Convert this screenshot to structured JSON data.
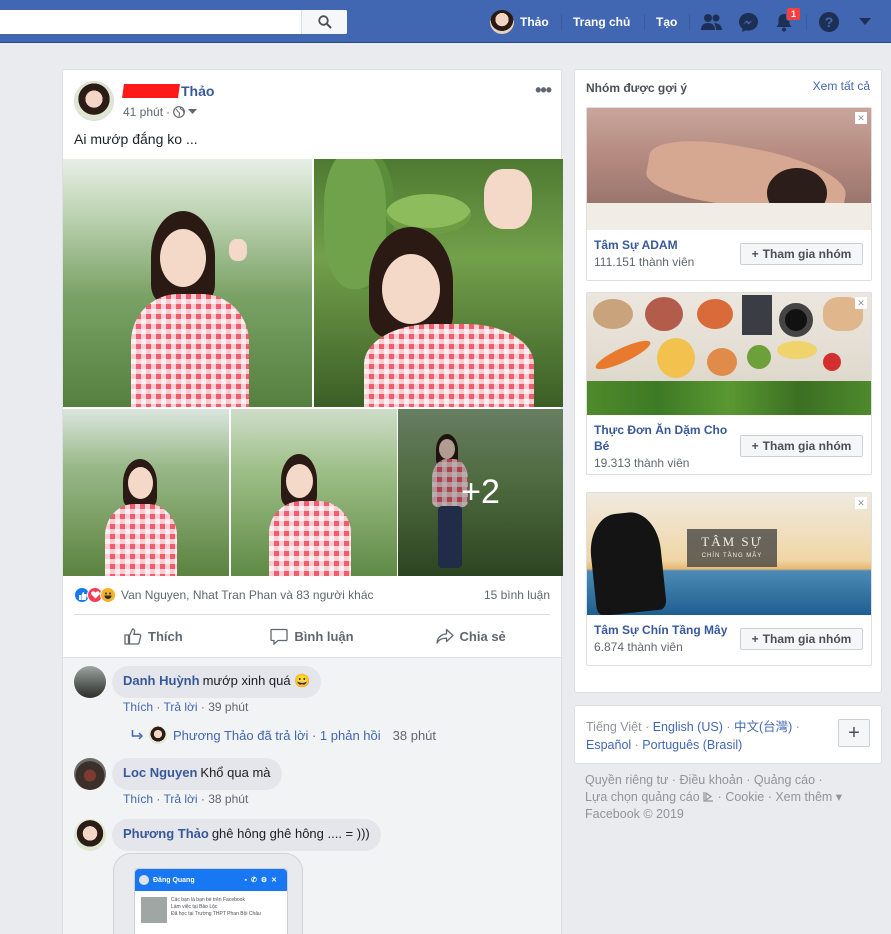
{
  "topbar": {
    "user_name": "Thảo",
    "home_label": "Trang chủ",
    "create_label": "Tạo",
    "notification_count": "1",
    "search_placeholder": ""
  },
  "post": {
    "author_visible": "Thảo",
    "time": "41 phút",
    "text": "Ai mướp đắng ko ...",
    "more_photos": "+2",
    "reactions_text": "Van Nguyen, Nhat Tran Phan và 83 người khác",
    "comments_count": "15 bình luận",
    "actions": {
      "like": "Thích",
      "comment": "Bình luận",
      "share": "Chia sẻ"
    }
  },
  "comments": [
    {
      "name": "Danh Huỳnh",
      "text": "mướp xinh quá 😀",
      "like": "Thích",
      "reply": "Trả lời",
      "time": "39 phút"
    },
    {
      "name": "Loc Nguyen",
      "text": "Khổ qua mà",
      "like": "Thích",
      "reply": "Trả lời",
      "time": "38 phút"
    },
    {
      "name": "Phương Thảo",
      "text": "ghê hông ghê hông .... = )))"
    }
  ],
  "reply_summary": {
    "text": "Phương Thảo đã trả lời · 1 phản hồi",
    "time": "38 phút"
  },
  "embedded_chat": {
    "contact": "Đăng Quang",
    "line1": "Các bạn là bạn bè trên Facebook",
    "line2": "Làm việc tại Bảo Lộc",
    "line3": "Đã học tại Trường THPT Phan Bội Châu"
  },
  "sidebar": {
    "title": "Nhóm được gợi ý",
    "see_all": "Xem tất cả",
    "join_label": "Tham gia nhóm",
    "groups": [
      {
        "name": "Tâm Sự ADAM",
        "members": "111.151 thành viên"
      },
      {
        "name": "Thực Đơn Ăn Dặm Cho Bé",
        "members": "19.313 thành viên"
      },
      {
        "name": "Tâm Sự Chín Tầng Mây",
        "members": "6.874 thành viên",
        "image_title": "TÂM SỰ",
        "image_subtitle": "CHÍN TẦNG MÂY"
      }
    ]
  },
  "languages": {
    "current": "Tiếng Việt",
    "others": [
      "English (US)",
      "中文(台灣)",
      "Español",
      "Português (Brasil)"
    ]
  },
  "footer": {
    "links": [
      "Quyền riêng tư",
      "Điều khoản",
      "Quảng cáo",
      "Lựa chọn quảng cáo",
      "Cookie",
      "Xem thêm"
    ],
    "copyright": "Facebook © 2019"
  },
  "colors": {
    "brand": "#4267b2",
    "link": "#385898",
    "background": "#e9ebee"
  }
}
